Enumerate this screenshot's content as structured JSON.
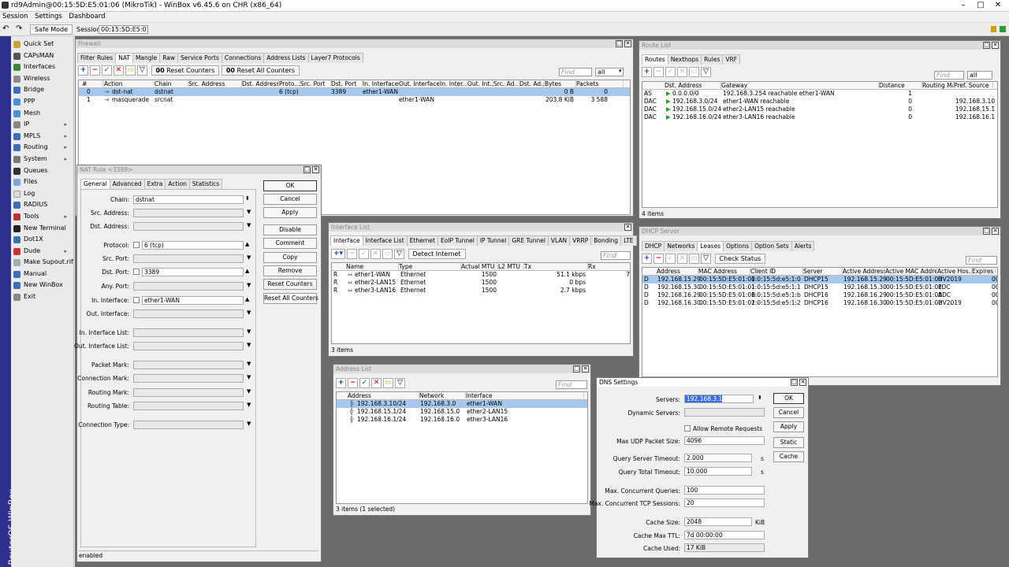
{
  "window_title": "rd9Admin@00:15:5D:E5:01:06 (MikroTik) - WinBox v6.45.6 on CHR (x86_64)",
  "menu": [
    "Session",
    "Settings",
    "Dashboard"
  ],
  "toolbar": {
    "safe_mode": "Safe Mode",
    "session_label": "Session:",
    "session_value": "00:15:5D:E5:01:06"
  },
  "brand": "RouterOS WinBox",
  "sidebar": [
    "Quick Set",
    "CAPsMAN",
    "Interfaces",
    "Wireless",
    "Bridge",
    "PPP",
    "Mesh",
    "IP",
    "MPLS",
    "Routing",
    "System",
    "Queues",
    "Files",
    "Log",
    "RADIUS",
    "Tools",
    "New Terminal",
    "Dot1X",
    "Dude",
    "Make Supout.rif",
    "Manual",
    "New WinBox",
    "Exit"
  ],
  "firewall": {
    "title": "Firewall",
    "tabs": [
      "Filter Rules",
      "NAT",
      "Mangle",
      "Raw",
      "Service Ports",
      "Connections",
      "Address Lists",
      "Layer7 Protocols"
    ],
    "reset_counters": "Reset Counters",
    "reset_all": "Reset All Counters",
    "find": "Find",
    "filter": "all",
    "columns": [
      "#",
      "Action",
      "Chain",
      "Src. Address",
      "Dst. Address",
      "Proto...",
      "Src. Port",
      "Dst. Port",
      "In. Interface",
      "Out. Interface",
      "In. Inter...",
      "Out. Int...",
      "Src. Ad...",
      "Dst. Ad...",
      "Bytes",
      "Packets"
    ],
    "rows": [
      [
        "0",
        "dst-nat",
        "dstnat",
        "",
        "",
        "6 (tcp)",
        "",
        "3389",
        "ether1-WAN",
        "",
        "",
        "",
        "",
        "",
        "0 B",
        "0"
      ],
      [
        "1",
        "masquerade",
        "srcnat",
        "",
        "",
        "",
        "",
        "",
        "",
        "ether1-WAN",
        "",
        "",
        "",
        "",
        "203.8 KiB",
        "3 588"
      ]
    ]
  },
  "natrule": {
    "title": "NAT Rule <3389>",
    "tabs": [
      "General",
      "Advanced",
      "Extra",
      "Action",
      "Statistics"
    ],
    "buttons": [
      "OK",
      "Cancel",
      "Apply",
      "Disable",
      "Comment",
      "Copy",
      "Remove",
      "Reset Counters",
      "Reset All Counters"
    ],
    "fields": {
      "chain": "Chain:",
      "chain_v": "dstnat",
      "src": "Src. Address:",
      "dst": "Dst. Address:",
      "proto": "Protocol:",
      "proto_v": "6 (tcp)",
      "sport": "Src. Port:",
      "dport": "Dst. Port:",
      "dport_v": "3389",
      "aport": "Any. Port:",
      "inif": "In. Interface:",
      "inif_v": "ether1-WAN",
      "outif": "Out. Interface:",
      "iniflist": "In. Interface List:",
      "outiflist": "Out. Interface List:",
      "pmark": "Packet Mark:",
      "cmark": "Connection Mark:",
      "rmark": "Routing Mark:",
      "rtable": "Routing Table:",
      "ctype": "Connection Type:"
    },
    "status": "enabled"
  },
  "routes": {
    "title": "Route List",
    "tabs": [
      "Routes",
      "Nexthops",
      "Rules",
      "VRF"
    ],
    "find": "Find",
    "filter": "all",
    "columns": [
      "",
      "Dst. Address",
      "Gateway",
      "Distance",
      "Routing Mark",
      "Pref. Source"
    ],
    "rows": [
      [
        "AS",
        "0.0.0.0/0",
        "192.168.3.254 reachable ether1-WAN",
        "1",
        "",
        ""
      ],
      [
        "DAC",
        "192.168.3.0/24",
        "ether1-WAN reachable",
        "0",
        "",
        "192.168.3.10"
      ],
      [
        "DAC",
        "192.168.15.0/24",
        "ether2-LAN15 reachable",
        "0",
        "",
        "192.168.15.1"
      ],
      [
        "DAC",
        "192.168.16.0/24",
        "ether3-LAN16 reachable",
        "0",
        "",
        "192.168.16.1"
      ]
    ],
    "status": "4 items"
  },
  "iflist": {
    "title": "Interface List",
    "tabs": [
      "Interface",
      "Interface List",
      "Ethernet",
      "EoIP Tunnel",
      "IP Tunnel",
      "GRE Tunnel",
      "VLAN",
      "VRRP",
      "Bonding",
      "LTE"
    ],
    "detect": "Detect Internet",
    "find": "Find",
    "columns": [
      "",
      "Name",
      "Type",
      "Actual MTU",
      "L2 MTU",
      "Tx",
      "Rx"
    ],
    "rows": [
      [
        "R",
        "ether1-WAN",
        "Ethernet",
        "1500",
        "",
        "51.1 kbps",
        "7"
      ],
      [
        "R",
        "ether2-LAN15",
        "Ethernet",
        "1500",
        "",
        "0 bps",
        ""
      ],
      [
        "R",
        "ether3-LAN16",
        "Ethernet",
        "1500",
        "",
        "2.7 kbps",
        ""
      ]
    ],
    "status": "3 items"
  },
  "dhcp": {
    "title": "DHCP Server",
    "tabs": [
      "DHCP",
      "Networks",
      "Leases",
      "Options",
      "Option Sets",
      "Alerts"
    ],
    "check": "Check Status",
    "find": "Find",
    "columns": [
      "",
      "Address",
      "MAC Address",
      "Client ID",
      "Server",
      "Active Address",
      "Active MAC Addre...",
      "Active Hos...",
      "Expires"
    ],
    "rows": [
      [
        "D",
        "192.168.15.29",
        "00:15:5D:E5:01:00",
        "1:0:15:5d:e5:1:0",
        "DHCP15",
        "192.168.15.29",
        "00:15:5D:E5:01:00",
        "HV2019",
        "00"
      ],
      [
        "D",
        "192.168.15.30",
        "00:15:5D:E5:01:01",
        "1:0:15:5d:e5:1:1",
        "DHCP15",
        "192.168.15.30",
        "00:15:5D:E5:01:01",
        "PDC",
        "00"
      ],
      [
        "D",
        "192.168.16.29",
        "00:15:5D:E5:01:0B",
        "1:0:15:5d:e5:1:b",
        "DHCP16",
        "192.168.16.29",
        "00:15:5D:E5:01:0B",
        "ADC",
        "00"
      ],
      [
        "D",
        "192.168.16.30",
        "00:15:5D:E5:01:02",
        "1:0:15:5d:e5:1:2",
        "DHCP16",
        "192.168.16.30",
        "00:15:5D:E5:01:02",
        "HV2019",
        "00"
      ]
    ]
  },
  "addr": {
    "title": "Address List",
    "find": "Find",
    "columns": [
      "Address",
      "Network",
      "Interface"
    ],
    "rows": [
      [
        "192.168.3.10/24",
        "192.168.3.0",
        "ether1-WAN"
      ],
      [
        "192.168.15.1/24",
        "192.168.15.0",
        "ether2-LAN15"
      ],
      [
        "192.168.16.1/24",
        "192.168.16.0",
        "ether3-LAN16"
      ]
    ],
    "status": "3 items (1 selected)"
  },
  "dns": {
    "title": "DNS Settings",
    "servers": "Servers:",
    "servers_v": "192.168.3.1",
    "dyn": "Dynamic Servers:",
    "allow": "Allow Remote Requests",
    "udp": "Max UDP Packet Size:",
    "udp_v": "4096",
    "qst": "Query Server Timeout:",
    "qst_v": "2.000",
    "qtt": "Query Total Timeout:",
    "qtt_v": "10.000",
    "mcq": "Max. Concurrent Queries:",
    "mcq_v": "100",
    "mct": "Max. Concurrent TCP Sessions:",
    "mct_v": "20",
    "csize": "Cache Size:",
    "csize_v": "2048",
    "cttl": "Cache Max TTL:",
    "cttl_v": "7d 00:00:00",
    "cused": "Cache Used:",
    "cused_v": "17 KiB",
    "unit_s": "s",
    "unit_kib": "KiB",
    "buttons": [
      "OK",
      "Cancel",
      "Apply",
      "Static",
      "Cache"
    ]
  }
}
